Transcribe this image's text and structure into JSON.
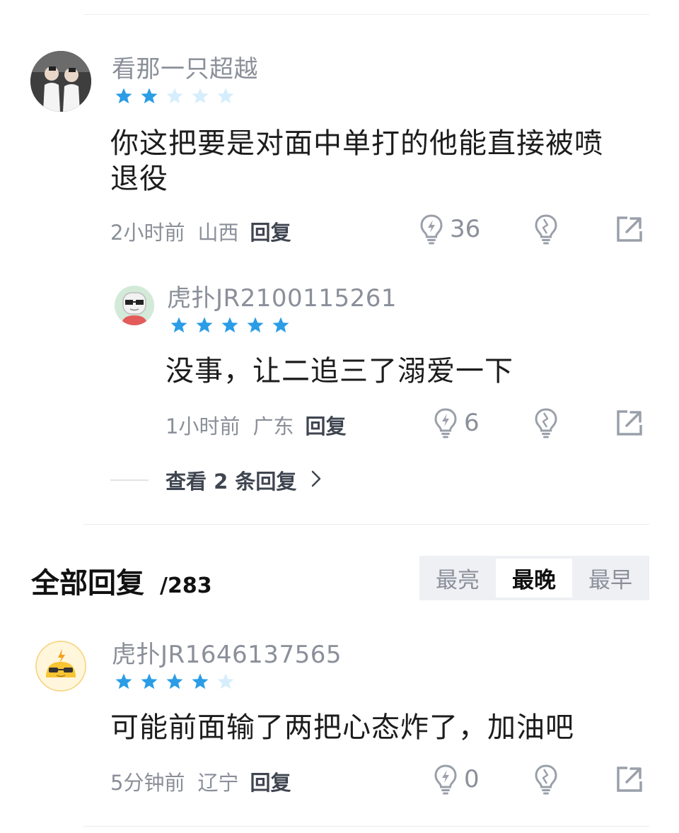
{
  "comments": [
    {
      "username": "看那一只超越",
      "stars": 2,
      "text_line1": "你这把要是对面中单打的他能直接被喷",
      "text_line2": "退役",
      "time": "2小时前",
      "location": "山西",
      "reply_label": "回复",
      "like_count": "36"
    },
    {
      "username": "虎扑JR2100115261",
      "stars": 5,
      "text": "没事，让二追三了溺爱一下",
      "time": "1小时前",
      "location": "广东",
      "reply_label": "回复",
      "like_count": "6"
    },
    {
      "username": "虎扑JR1646137565",
      "stars": 4,
      "text": "可能前面输了两把心态炸了，加油吧",
      "time": "5分钟前",
      "location": "辽宁",
      "reply_label": "回复",
      "like_count": "0"
    }
  ],
  "view_replies": "查看 2 条回复",
  "all_replies": {
    "title": "全部回复",
    "count": "/283"
  },
  "sort_options": [
    "最亮",
    "最晚",
    "最早"
  ],
  "sort_active": "最晚",
  "colors": {
    "star_on": "#2a9de6",
    "star_off": "#d6eefb",
    "icon_gray": "#9aa0aa"
  },
  "icons": {
    "like": "lightbulb-icon",
    "dislike": "broken-lightbulb-icon",
    "share": "share-icon",
    "chevron": "chevron-right-icon"
  }
}
